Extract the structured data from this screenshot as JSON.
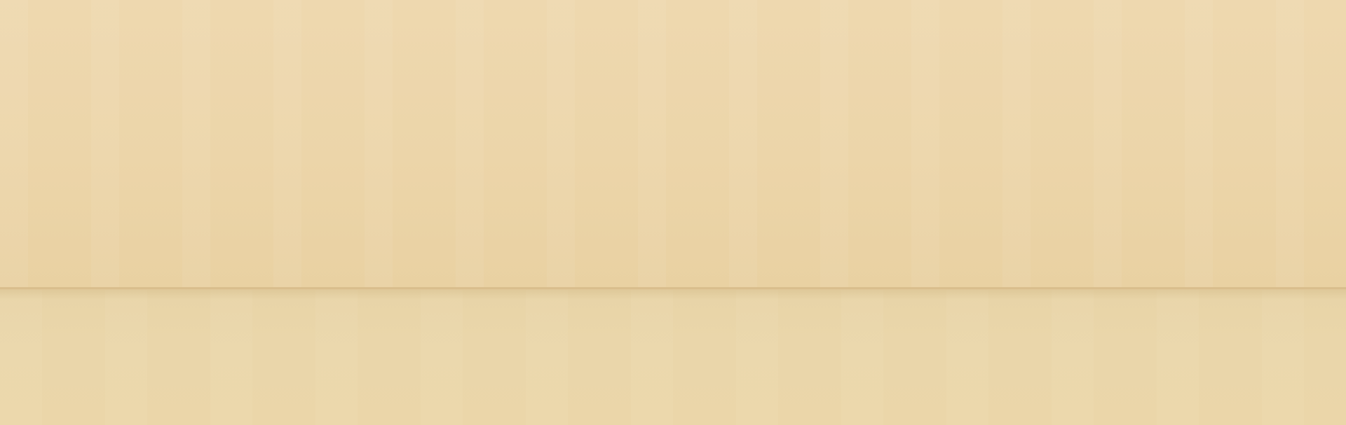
{
  "colors": {
    "upper_panel": "#ecd5a9",
    "seam": "#d7bb89",
    "lower_panel": "#ead6aa"
  }
}
